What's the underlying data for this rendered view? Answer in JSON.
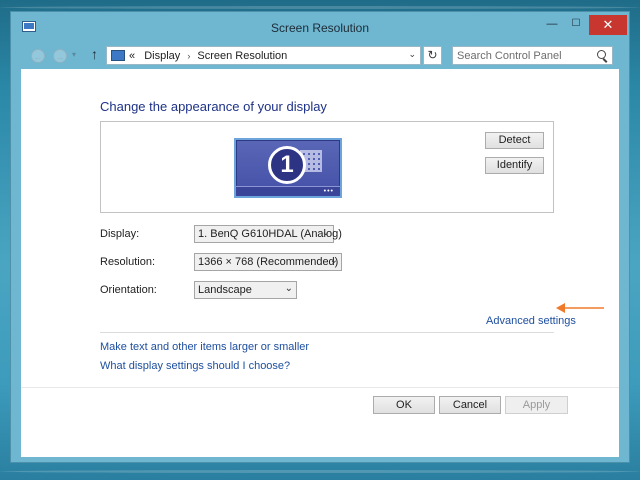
{
  "window": {
    "title": "Screen Resolution",
    "controls": {
      "minimize": "—",
      "maximize": "☐",
      "close": "✕"
    }
  },
  "navbar": {
    "back": "←",
    "forward": "→",
    "recent": "▾",
    "up": "↑",
    "breadcrumb_prefix": "«",
    "breadcrumb": [
      "Display",
      "Screen Resolution"
    ],
    "breadcrumb_separator": "›",
    "dropdown": "⌄",
    "refresh": "↻",
    "search_placeholder": "Search Control Panel"
  },
  "main": {
    "heading": "Change the appearance of your display",
    "monitor": {
      "number": "1"
    },
    "detect_label": "Detect",
    "identify_label": "Identify",
    "fields": [
      {
        "label": "Display:",
        "value": "1. BenQ G610HDAL (Analog)"
      },
      {
        "label": "Resolution:",
        "value": "1366 × 768 (Recommended)"
      },
      {
        "label": "Orientation:",
        "value": "Landscape"
      }
    ],
    "advanced_settings": "Advanced settings",
    "links": [
      "Make text and other items larger or smaller",
      "What display settings should I choose?"
    ]
  },
  "footer": {
    "ok": "OK",
    "cancel": "Cancel",
    "apply": "Apply"
  },
  "annotation": {
    "arrow_color": "#f07a2a"
  }
}
